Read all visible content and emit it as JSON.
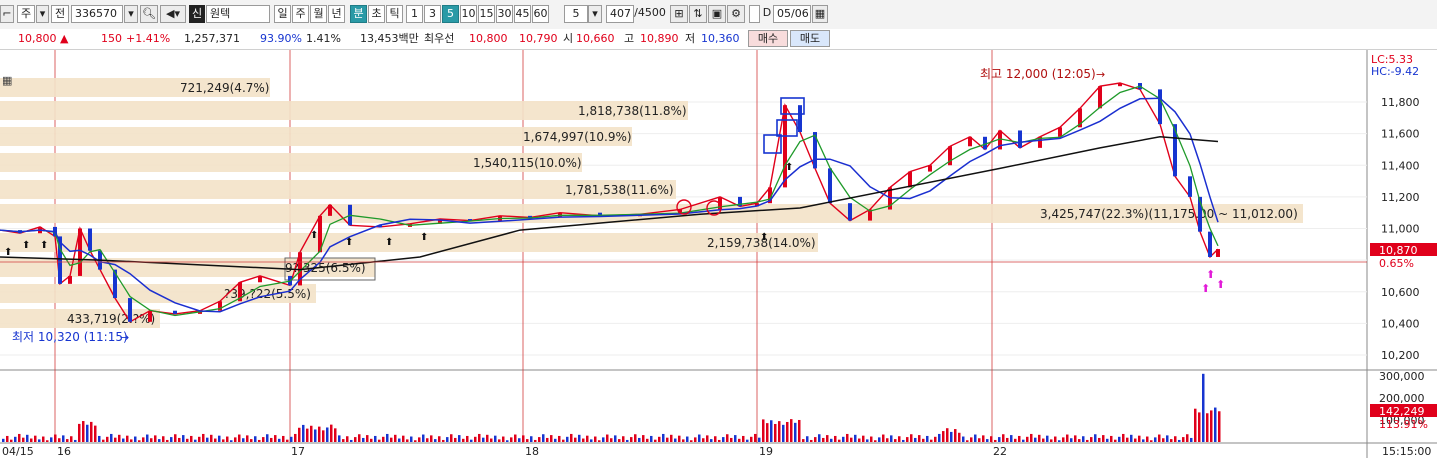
{
  "toolbar": {
    "menu_glyph": "⌐",
    "stock_type": "주",
    "prev_label": "전",
    "code": "336570",
    "krx_badge": "신",
    "name": "원텍",
    "periods": [
      "일",
      "주",
      "월",
      "년",
      "분",
      "초",
      "틱",
      "1",
      "3",
      "5",
      "10",
      "15",
      "30",
      "45",
      "60"
    ],
    "active_periods": [
      "분",
      "5"
    ],
    "interval_value": "5",
    "count_value": "407",
    "count_total": "/4500",
    "d_label": "D",
    "date_value": "05/06"
  },
  "quote": {
    "price": "10,800",
    "change_arrow": "▲",
    "change": "150",
    "change_pct": "+1.41%",
    "volume": "1,257,371",
    "vol_ratio": "93.90%",
    "turnover": "1.41%",
    "amount": "13,453백만",
    "best_label": "최우선",
    "best_ask": "10,800",
    "best_bid": "10,790",
    "open_label": "시",
    "open": "10,660",
    "high_label": "고",
    "high": "10,890",
    "low_label": "저",
    "low": "10,360",
    "buy_label": "매수",
    "sell_label": "매도"
  },
  "chart": {
    "lc_label": "LC:5.33",
    "hc_label": "HC:-9.42",
    "price_ticks": [
      "11,800",
      "11,600",
      "11,400",
      "11,200",
      "11,000",
      "10,600",
      "10,400",
      "10,200"
    ],
    "current_price_tag": "10,870",
    "current_pct_tag": "0.65%",
    "volume_ticks": [
      "300,000",
      "200,000",
      "100,000"
    ],
    "volume_tag": "142,249",
    "volume_pct_tag": "113.91%",
    "date_labels": [
      "04/15",
      "16",
      "17",
      "18",
      "19",
      "22"
    ],
    "time_label": "15:15:00",
    "high_annotation": "최고 12,000 (12:05)",
    "low_annotation": "최저 10,320 (11:15)",
    "volume_profile": [
      {
        "label": "721,249(4.7%)"
      },
      {
        "label": "1,818,738(11.8%)"
      },
      {
        "label": "1,674,997(10.9%)"
      },
      {
        "label": "1,540,115(10.0%)"
      },
      {
        "label": "1,781,538(11.6%)"
      },
      {
        "label": "3,425,747(22.3%)(11,175.00 ~ 11,012.00)"
      },
      {
        "label": "2,159,738(14.0%)"
      },
      {
        "label": "9?,325(6.5%)"
      },
      {
        "label": "?39,?22(5.5%)"
      },
      {
        "label": "433,719(2.?%)"
      }
    ]
  },
  "colors": {
    "up": "#e0001b",
    "down": "#1735d0",
    "ma_short": "#1f9a2a",
    "ma_mid": "#1b2fd0",
    "ma_long": "#111111",
    "profile": "#f3e2c8"
  },
  "icons": [
    "menu-icon",
    "dropdown-icon",
    "search-icon",
    "sound-icon",
    "chart-type-icon",
    "save-icon",
    "settings-icon",
    "calendar-icon",
    "grid-icon"
  ]
}
